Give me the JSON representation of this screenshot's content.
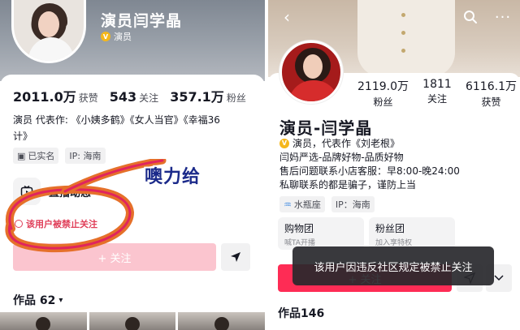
{
  "left": {
    "profile": {
      "name": "演员闫学晶",
      "verified_label": "演员",
      "stats": [
        {
          "value": "2011.0万",
          "label": "获赞"
        },
        {
          "value": "543",
          "label": "关注"
        },
        {
          "value": "357.1万",
          "label": "粉丝"
        }
      ],
      "bio_line1": "演员 代表作: 《小姨多鹤》《女人当官》《幸福36",
      "bio_line2": "计》",
      "tags": [
        {
          "icon": "id-card-icon",
          "label": "已实名"
        },
        {
          "label": "IP: 海南"
        }
      ],
      "live_label": "直播动态",
      "banned_notice": "该用户被禁止关注",
      "follow_label": "+ 关注",
      "works_label": "作品 62",
      "works_caret": "▾"
    },
    "annotation_text": "噢力给",
    "colors": {
      "scribble_outer": "#e5702a",
      "scribble_inner": "#e0245e",
      "annotation": "#1b2a8a"
    }
  },
  "right": {
    "nav": {
      "back_icon": "‹",
      "search_icon": "⌕",
      "more_icon": "···"
    },
    "profile": {
      "stats": [
        {
          "value": "2119.0万",
          "label": "粉丝"
        },
        {
          "value": "1811",
          "label": "关注"
        },
        {
          "value": "6116.1万",
          "label": "获赞"
        }
      ],
      "name": "演员-闫学晶",
      "verified_text": "演员，代表作《刘老根》",
      "bio_line1": "闫妈严选-品牌好物-品质好物",
      "bio_line2": "售后问题联系小店客服：早8:00-晚24:00",
      "bio_line3": "私聊联系的都是骗子，谨防上当",
      "tags": [
        {
          "icon": "aquarius-icon",
          "label": "水瓶座"
        },
        {
          "label": "IP：海南"
        }
      ],
      "shops": [
        {
          "title": "购物团",
          "subtitle": "喊TA开播"
        },
        {
          "title": "粉丝团",
          "subtitle": "加入享特权"
        }
      ],
      "follow_label": "+ 关注",
      "works_label": "作品146"
    },
    "toast": "该用户因违反社区规定被禁止关注",
    "colors": {
      "follow_btn": "#fe2c55",
      "verify_badge": "#f5b71b"
    }
  }
}
